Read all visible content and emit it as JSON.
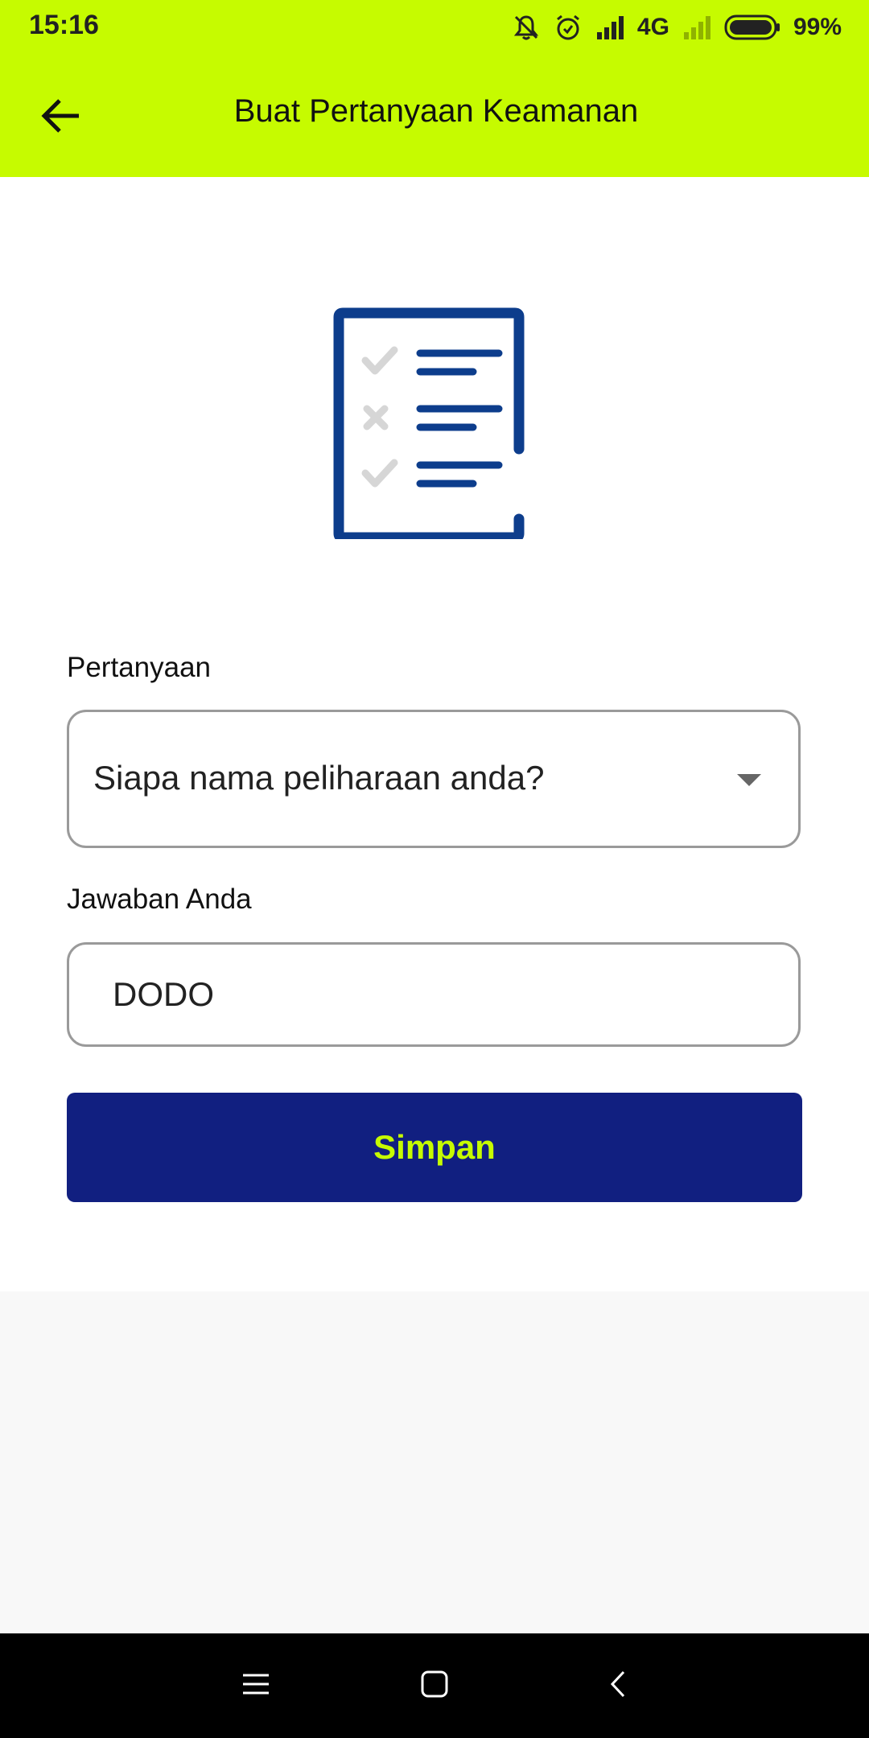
{
  "status_bar": {
    "time": "15:16",
    "network": "4G",
    "battery": "99%"
  },
  "header": {
    "title": "Buat Pertanyaan Keamanan",
    "back_icon": "arrow-left-icon"
  },
  "illustration": {
    "icon": "checklist-document-icon",
    "color": "#0d3d8c"
  },
  "form": {
    "question_label": "Pertanyaan",
    "question_value": "Siapa nama peliharaan anda?",
    "answer_label": "Jawaban Anda",
    "answer_value": "DODO",
    "save_label": "Simpan"
  },
  "colors": {
    "accent": "#c6fb00",
    "primary_button": "#111f80",
    "button_text": "#c6fb00"
  },
  "nav_bar": {
    "icons": [
      "menu-icon",
      "home-icon",
      "back-icon"
    ]
  }
}
